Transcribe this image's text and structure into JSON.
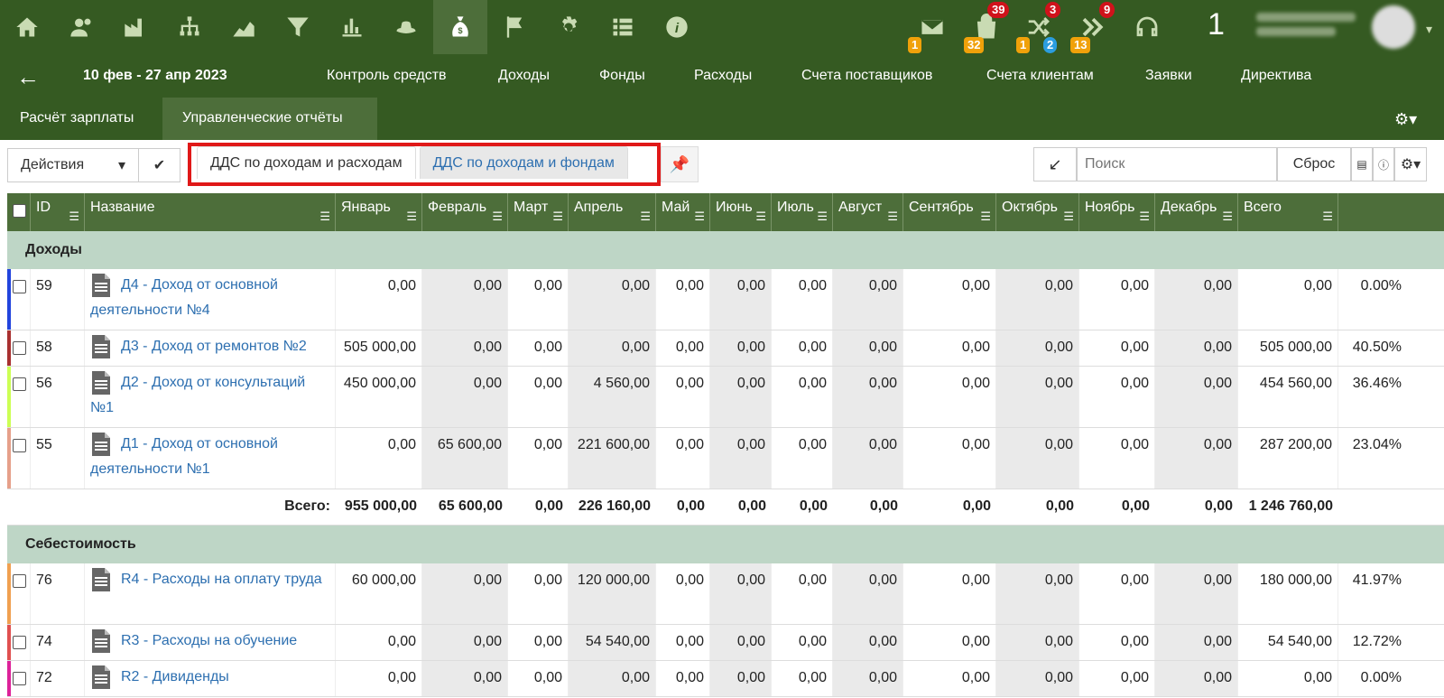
{
  "top_nav": {
    "icons": [
      "home-icon",
      "users-icon",
      "factory-icon",
      "hierarchy-icon",
      "area-chart-icon",
      "filter-icon",
      "bar-chart-icon",
      "hat-icon",
      "money-bag-icon",
      "flag-icon",
      "gear-icon",
      "list-icon",
      "info-icon"
    ],
    "active_icon": "money-bag-icon",
    "notifications": {
      "mail_orange": "1",
      "bag_red": "39",
      "bag_orange": "32",
      "shuffle_red": "3",
      "shuffle_orange": "1",
      "shuffle_blue": "2",
      "forward_red": "9",
      "forward_orange": "13"
    },
    "user_number": "1"
  },
  "nav": {
    "date_range": "10 фев - 27 апр 2023",
    "links": [
      "Контроль средств",
      "Доходы",
      "Фонды",
      "Расходы",
      "Счета поставщиков",
      "Счета клиентам",
      "Заявки",
      "Директива"
    ]
  },
  "tabs": {
    "salary": "Расчёт зарплаты",
    "reports": "Управленческие отчёты"
  },
  "toolbar": {
    "actions": "Действия",
    "subtab_income_expense": "ДДС по доходам и расходам",
    "subtab_income_funds": "ДДС по доходам и фондам",
    "search_placeholder": "Поиск",
    "reset": "Сброс"
  },
  "table": {
    "headers": [
      "ID",
      "Название",
      "Январь",
      "Февраль",
      "Март",
      "Апрель",
      "Май",
      "Июнь",
      "Июль",
      "Август",
      "Сентябрь",
      "Октябрь",
      "Ноябрь",
      "Декабрь",
      "Всего"
    ],
    "sections": [
      {
        "title": "Доходы",
        "rows": [
          {
            "id": "59",
            "name": "Д4 - Доход от основной деятельности №4",
            "color": "#2244dd",
            "values": [
              "0,00",
              "0,00",
              "0,00",
              "0,00",
              "0,00",
              "0,00",
              "0,00",
              "0,00",
              "0,00",
              "0,00",
              "0,00",
              "0,00",
              "0,00"
            ],
            "pct": "0.00%"
          },
          {
            "id": "58",
            "name": "Д3 - Доход от ремонтов №2",
            "color": "#a83030",
            "values": [
              "505 000,00",
              "0,00",
              "0,00",
              "0,00",
              "0,00",
              "0,00",
              "0,00",
              "0,00",
              "0,00",
              "0,00",
              "0,00",
              "0,00",
              "505 000,00"
            ],
            "pct": "40.50%"
          },
          {
            "id": "56",
            "name": "Д2 - Доход от консультаций №1",
            "color": "#ccff55",
            "values": [
              "450 000,00",
              "0,00",
              "0,00",
              "4 560,00",
              "0,00",
              "0,00",
              "0,00",
              "0,00",
              "0,00",
              "0,00",
              "0,00",
              "0,00",
              "454 560,00"
            ],
            "pct": "36.46%"
          },
          {
            "id": "55",
            "name": "Д1 - Доход от основной деятельности №1",
            "color": "#e6a08a",
            "values": [
              "0,00",
              "65 600,00",
              "0,00",
              "221 600,00",
              "0,00",
              "0,00",
              "0,00",
              "0,00",
              "0,00",
              "0,00",
              "0,00",
              "0,00",
              "287 200,00"
            ],
            "pct": "23.04%"
          }
        ],
        "total_label": "Всего:",
        "totals": [
          "955 000,00",
          "65 600,00",
          "0,00",
          "226 160,00",
          "0,00",
          "0,00",
          "0,00",
          "0,00",
          "0,00",
          "0,00",
          "0,00",
          "0,00",
          "1 246 760,00"
        ]
      },
      {
        "title": "Себестоимость",
        "rows": [
          {
            "id": "76",
            "name": "R4 - Расходы на оплату труда",
            "color": "#f0a050",
            "values": [
              "60 000,00",
              "0,00",
              "0,00",
              "120 000,00",
              "0,00",
              "0,00",
              "0,00",
              "0,00",
              "0,00",
              "0,00",
              "0,00",
              "0,00",
              "180 000,00"
            ],
            "pct": "41.97%"
          },
          {
            "id": "74",
            "name": "R3 - Расходы на обучение",
            "color": "#e05050",
            "values": [
              "0,00",
              "0,00",
              "0,00",
              "54 540,00",
              "0,00",
              "0,00",
              "0,00",
              "0,00",
              "0,00",
              "0,00",
              "0,00",
              "0,00",
              "54 540,00"
            ],
            "pct": "12.72%"
          },
          {
            "id": "72",
            "name": "R2 - Дивиденды",
            "color": "#dd2299",
            "values": [
              "0,00",
              "0,00",
              "0,00",
              "0,00",
              "0,00",
              "0,00",
              "0,00",
              "0,00",
              "0,00",
              "0,00",
              "0,00",
              "0,00",
              "0,00"
            ],
            "pct": "0.00%"
          }
        ]
      }
    ]
  },
  "colors": {
    "header_green": "#355a22",
    "active_green": "#4d6e3a",
    "section_bg": "#bed6c6",
    "link_blue": "#2d6fb0",
    "highlight_red": "#e01818"
  }
}
